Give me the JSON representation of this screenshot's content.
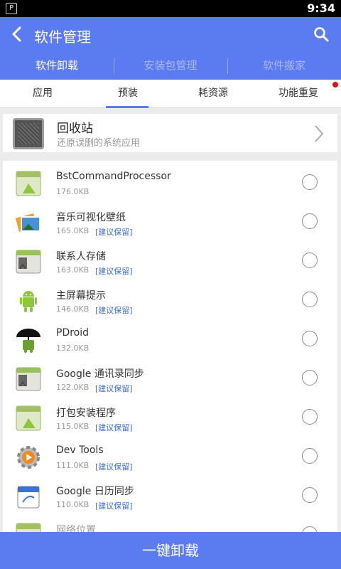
{
  "status_bar": {
    "time": "9:34",
    "notification_icon": "notification-icon"
  },
  "app_bar": {
    "back_icon": "back-arrow-icon",
    "title": "软件管理",
    "search_icon": "search-icon",
    "tabs": [
      {
        "label": "软件卸载",
        "active": true
      },
      {
        "label": "安装包管理",
        "active": false
      },
      {
        "label": "软件搬家",
        "active": false
      }
    ]
  },
  "sub_tabs": [
    {
      "label": "应用",
      "active": false
    },
    {
      "label": "预装",
      "active": true
    },
    {
      "label": "耗资源",
      "active": false
    },
    {
      "label": "功能重复",
      "active": false,
      "badge": true
    }
  ],
  "recycle_bin": {
    "name": "回收站",
    "description": "还原误删的系统应用",
    "icon": "recycle-bin-icon"
  },
  "apps": [
    {
      "name": "BstCommandProcessor",
      "size": "176.0KB",
      "tag": "",
      "icon": "android-package-icon"
    },
    {
      "name": "音乐可视化壁纸",
      "size": "165.0KB",
      "tag": "[建议保留]",
      "icon": "photo-gallery-icon"
    },
    {
      "name": "联系人存储",
      "size": "163.0KB",
      "tag": "[建议保留]",
      "icon": "system-package-icon"
    },
    {
      "name": "主屏幕提示",
      "size": "146.0KB",
      "tag": "[建议保留]",
      "icon": "android-robot-icon"
    },
    {
      "name": "PDroid",
      "size": "132.0KB",
      "tag": "",
      "icon": "android-umbrella-icon"
    },
    {
      "name": "Google 通讯录同步",
      "size": "122.0KB",
      "tag": "[建议保留]",
      "icon": "system-package-icon"
    },
    {
      "name": "打包安装程序",
      "size": "115.0KB",
      "tag": "[建议保留]",
      "icon": "android-package-icon"
    },
    {
      "name": "Dev Tools",
      "size": "111.0KB",
      "tag": "[建议保留]",
      "icon": "gear-icon"
    },
    {
      "name": "Google 日历同步",
      "size": "110.0KB",
      "tag": "[建议保留]",
      "icon": "calendar-icon"
    },
    {
      "name": "网络位置",
      "size": "",
      "tag": "",
      "icon": "android-package-icon"
    }
  ],
  "bottom_button": {
    "label": "一键卸载"
  },
  "colors": {
    "primary": "#5b7bf0",
    "tag": "#3a6fd8",
    "badge": "#e01010"
  }
}
